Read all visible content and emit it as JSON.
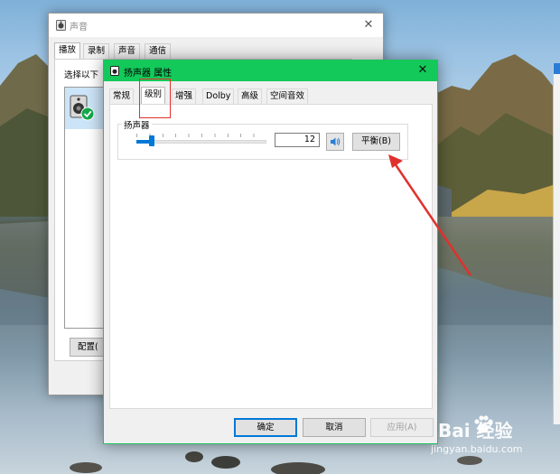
{
  "colors": {
    "dialog_titlebar": "#13c95a",
    "accent_blue": "#0078d7",
    "annotation_red": "#e0312d"
  },
  "sound_window": {
    "title": "声音",
    "close_glyph": "✕",
    "tabs": [
      {
        "label": "播放",
        "active": true
      },
      {
        "label": "录制",
        "active": false
      },
      {
        "label": "声音",
        "active": false
      },
      {
        "label": "通信",
        "active": false
      }
    ],
    "instruction": "选择以下",
    "configure_button": "配置("
  },
  "properties_dialog": {
    "title": "扬声器 属性",
    "close_glyph": "✕",
    "tabs": [
      {
        "label": "常规",
        "active": false
      },
      {
        "label": "级别",
        "active": true
      },
      {
        "label": "增强",
        "active": false
      },
      {
        "label": "Dolby",
        "active": false
      },
      {
        "label": "高级",
        "active": false
      },
      {
        "label": "空间音效",
        "active": false
      }
    ],
    "levels": {
      "group_label": "扬声器",
      "volume_value": "12",
      "volume_fraction": 0.12,
      "mute_icon": "speaker-icon",
      "balance_button": "平衡(B)"
    },
    "buttons": {
      "ok": "确定",
      "cancel": "取消",
      "apply": "应用(A)"
    }
  },
  "watermark": {
    "brand": "Bai 经验",
    "url": "jingyan.baidu.com"
  }
}
